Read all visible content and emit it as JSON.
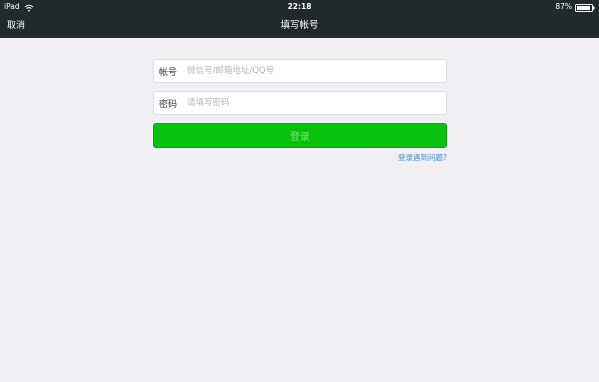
{
  "status_bar": {
    "device": "iPad",
    "time": "22:18",
    "battery": "87%"
  },
  "nav": {
    "cancel_label": "取消",
    "title": "填写帐号"
  },
  "form": {
    "account_label": "帐号",
    "account_placeholder": "微信号/邮箱地址/QQ号",
    "account_value": "",
    "password_label": "密码",
    "password_placeholder": "请填写密码",
    "password_value": "",
    "login_label": "登录",
    "help_link": "登录遇到问题?"
  },
  "colors": {
    "header_bg": "#22292c",
    "page_bg": "#efeff4",
    "login_button": "#08c10a",
    "link": "#4a90d9"
  }
}
